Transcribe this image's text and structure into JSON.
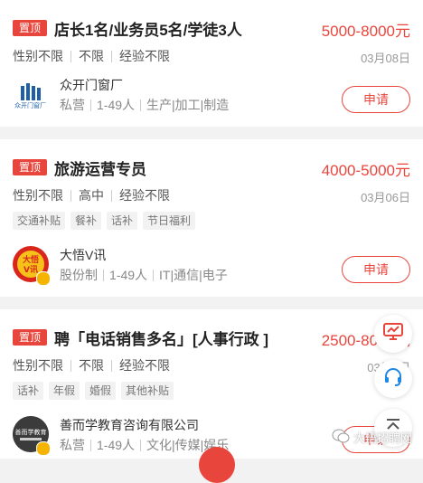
{
  "listings": [
    {
      "pin_label": "置顶",
      "title": "店长1名/业务员5名/学徒3人",
      "salary": "5000-8000元",
      "requirements": [
        "性别不限",
        "不限",
        "经验不限"
      ],
      "date": "03月08日",
      "tags": [],
      "company": {
        "name": "众开门窗厂",
        "type": "私营",
        "size": "1-49人",
        "industry": "生产|加工|制造",
        "logo_icon": "building-logo-icon",
        "logo_text": "众开门窗厂",
        "verified": false
      },
      "apply_label": "申请"
    },
    {
      "pin_label": "置顶",
      "title": "旅游运营专员",
      "salary": "4000-5000元",
      "requirements": [
        "性别不限",
        "高中",
        "经验不限"
      ],
      "date": "03月06日",
      "tags": [
        "交通补贴",
        "餐补",
        "话补",
        "节日福利"
      ],
      "company": {
        "name": "大悟V讯",
        "type": "股份制",
        "size": "1-49人",
        "industry": "IT|通信|电子",
        "logo_icon": "dawu-vxun-logo-icon",
        "logo_text": "大悟V讯",
        "verified": true
      },
      "apply_label": "申请"
    },
    {
      "pin_label": "置顶",
      "title": "聘「电话销售多名」[人事行政 ]",
      "salary": "2500-8000元",
      "requirements": [
        "性别不限",
        "不限",
        "经验不限"
      ],
      "date": "03月0日",
      "tags": [
        "话补",
        "年假",
        "婚假",
        "其他补贴"
      ],
      "company": {
        "name": "善而学教育咨询有限公司",
        "type": "私营",
        "size": "1-49人",
        "industry": "文化|传媒|娱乐",
        "logo_icon": "education-logo-icon",
        "logo_text": "善而学教育",
        "verified": true
      },
      "apply_label": "申请"
    }
  ],
  "float_buttons": {
    "publish_icon": "publish-screen-icon",
    "service_icon": "headset-icon",
    "top_icon": "back-to-top-icon"
  },
  "watermark": {
    "icon": "wechat-icon",
    "text": "大悟招聘网"
  },
  "colors": {
    "accent": "#e8453c",
    "pin_bg": "#e8453c",
    "verify_badge": "#f4b400"
  }
}
